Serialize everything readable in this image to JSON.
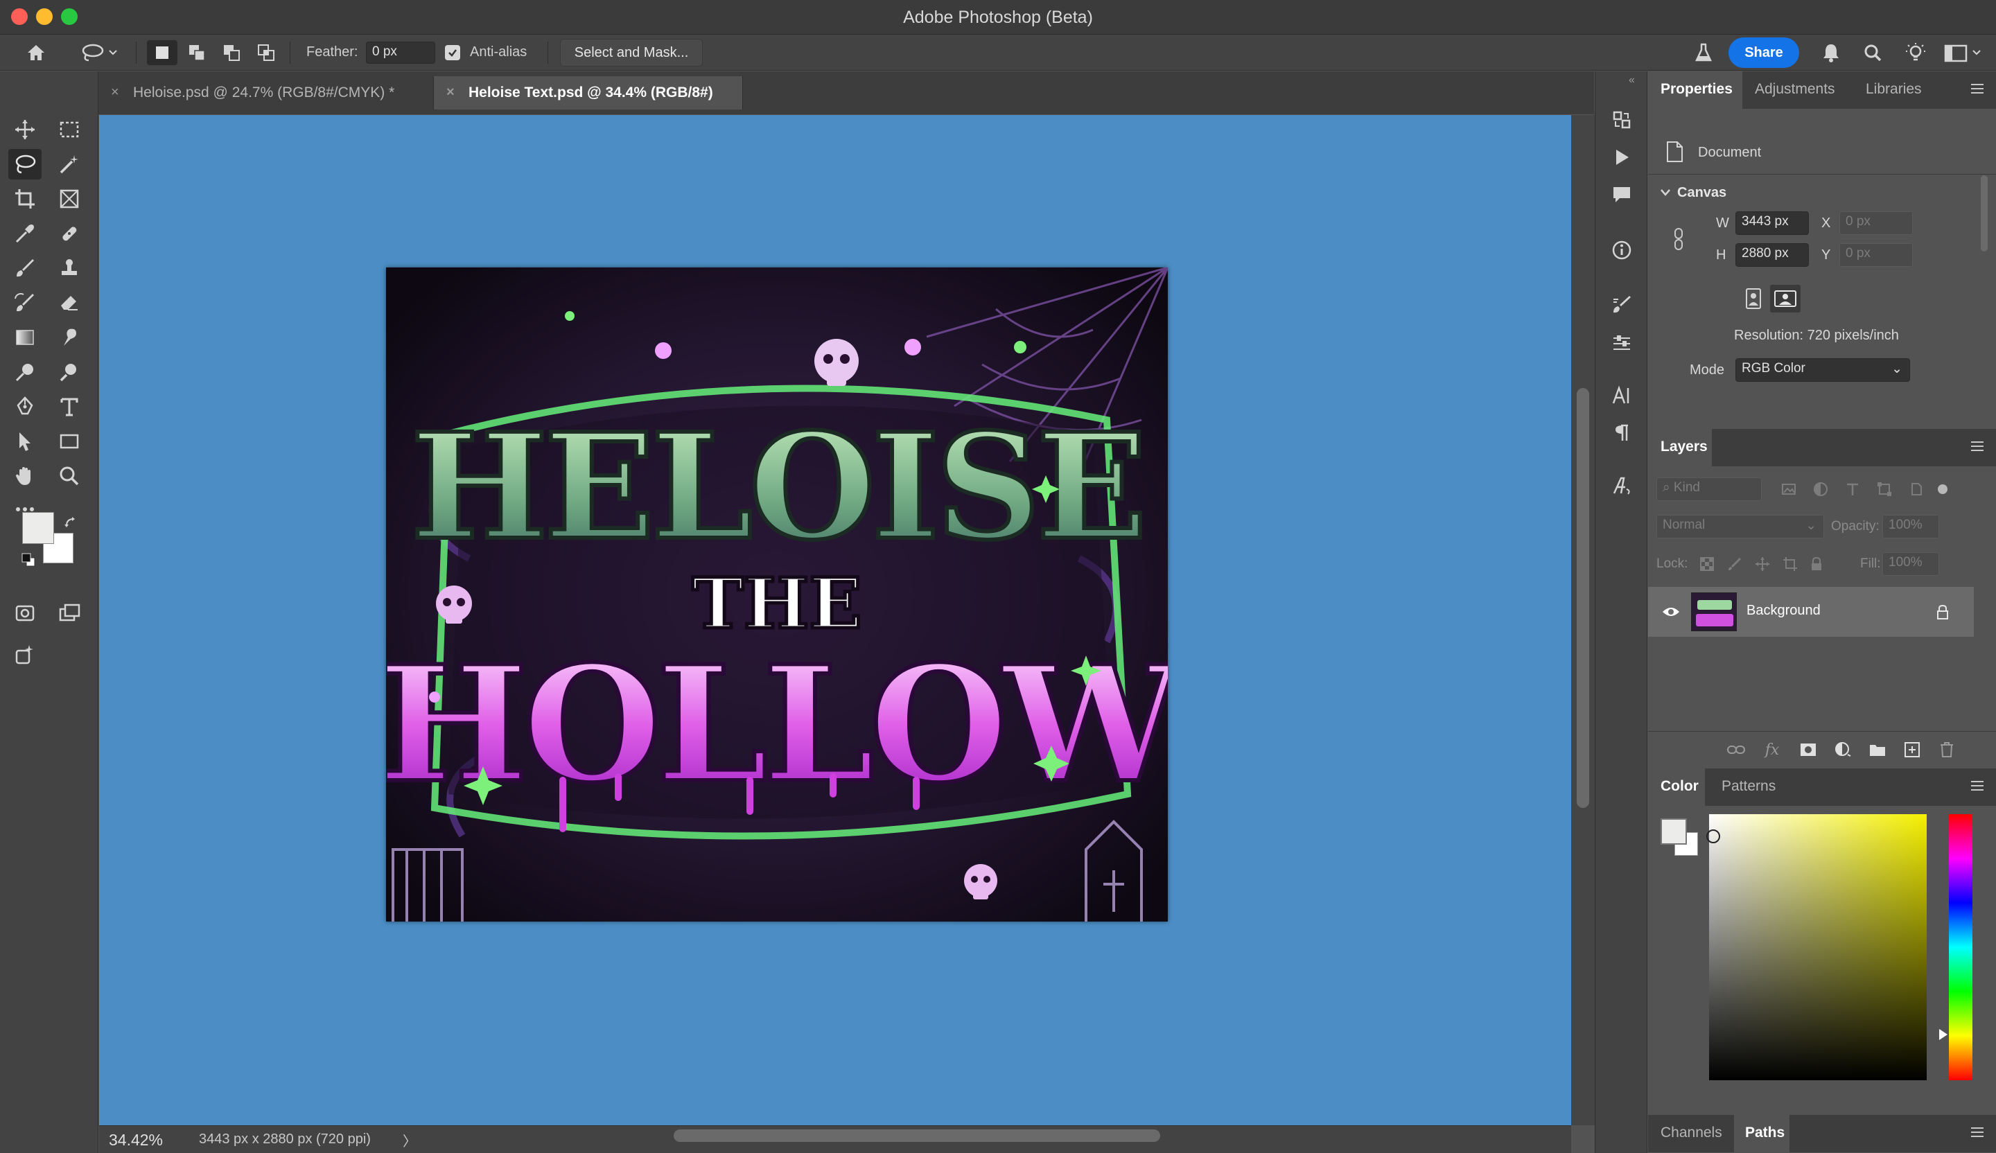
{
  "window": {
    "title": "Adobe Photoshop (Beta)"
  },
  "options": {
    "feather_label": "Feather:",
    "feather_value": "0 px",
    "antialias_label": "Anti-alias",
    "select_mask_label": "Select and Mask...",
    "share_label": "Share"
  },
  "tabs": [
    {
      "label": "Heloise.psd @ 24.7% (RGB/8#/CMYK) *",
      "close": "×"
    },
    {
      "label": "Heloise Text.psd @ 34.4% (RGB/8#)",
      "close": "×"
    }
  ],
  "artwork": {
    "line1": "HELOISE",
    "line2": "THE",
    "line3": "HOLLOW",
    "canvas_color": "#4b8dc4"
  },
  "status": {
    "zoom": "34.42%",
    "doc_info": "3443 px x 2880 px (720 ppi)",
    "arrow": "〉"
  },
  "properties": {
    "tabs": [
      "Properties",
      "Adjustments",
      "Libraries"
    ],
    "doc_label": "Document",
    "section": "Canvas",
    "w_label": "W",
    "w_value": "3443 px",
    "h_label": "H",
    "h_value": "2880 px",
    "x_label": "X",
    "x_placeholder": "0 px",
    "y_label": "Y",
    "y_placeholder": "0 px",
    "resolution": "Resolution: 720 pixels/inch",
    "mode_label": "Mode",
    "mode_value": "RGB Color"
  },
  "layers": {
    "tab": "Layers",
    "kind_placeholder": "Kind",
    "blend_mode": "Normal",
    "opacity_label": "Opacity:",
    "opacity_value": "100%",
    "lock_label": "Lock:",
    "fill_label": "Fill:",
    "fill_value": "100%",
    "items": [
      {
        "name": "Background"
      }
    ]
  },
  "color": {
    "tabs": [
      "Color",
      "Patterns"
    ]
  },
  "bottom_tabs": [
    "Channels",
    "Paths"
  ]
}
